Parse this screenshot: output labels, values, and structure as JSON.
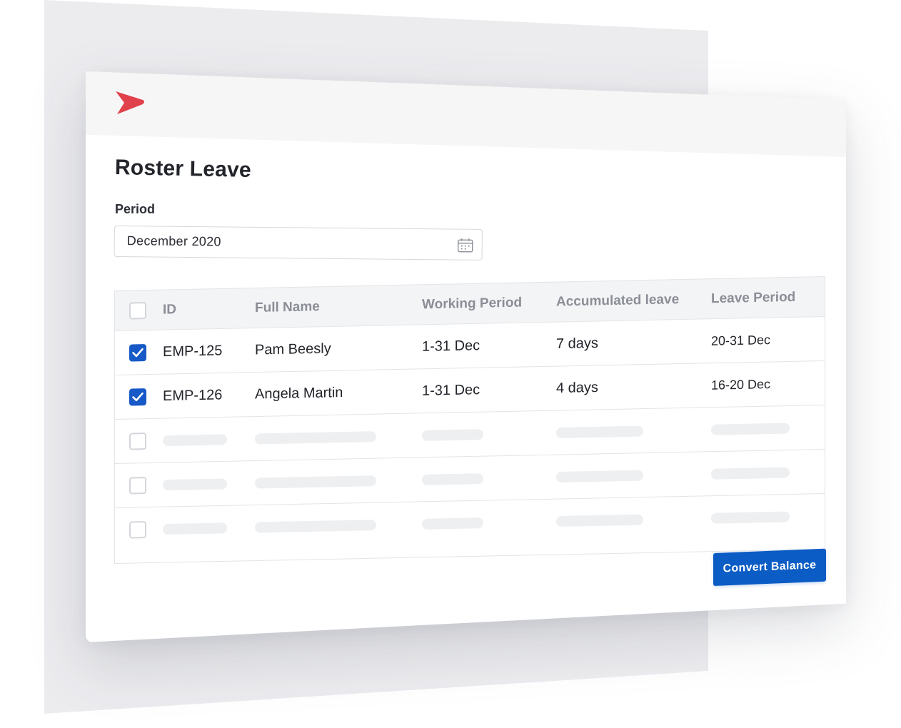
{
  "app": {
    "logo_icon": "brand-chevron-logo",
    "brand_color": "#e0414a",
    "accent_color": "#0b5cc4"
  },
  "page": {
    "title": "Roster Leave"
  },
  "period": {
    "label": "Period",
    "value": "December 2020",
    "icon": "calendar-icon"
  },
  "table": {
    "columns": [
      "ID",
      "Full Name",
      "Working Period",
      "Accumulated leave",
      "Leave Period"
    ],
    "rows": [
      {
        "checked": true,
        "id": "EMP-125",
        "full_name": "Pam Beesly",
        "working_period": "1-31 Dec",
        "accumulated_leave": "7 days",
        "leave_period": "20-31 Dec"
      },
      {
        "checked": true,
        "id": "EMP-126",
        "full_name": "Angela Martin",
        "working_period": "1-31 Dec",
        "accumulated_leave": "4 days",
        "leave_period": "16-20 Dec"
      }
    ],
    "placeholder_rows": 3
  },
  "actions": {
    "convert_label": "Convert Balance"
  }
}
